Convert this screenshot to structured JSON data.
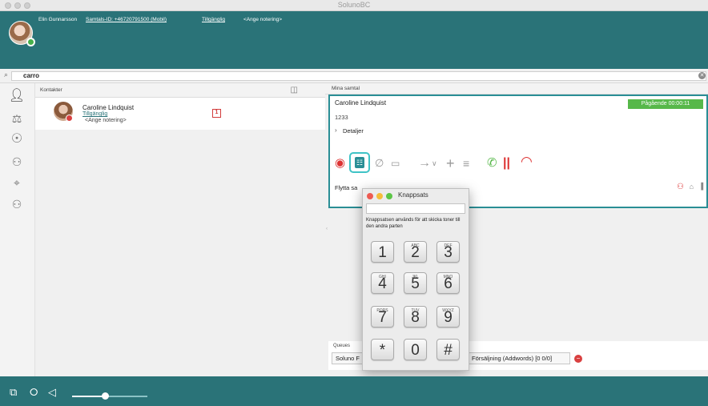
{
  "window": {
    "title": "SolunoBC"
  },
  "header": {
    "user_name": "Elin Gunnarsson",
    "call_id": "Samtals-ID: +46720791500 (Mobil)",
    "status": "Tillgänglig",
    "note": "<Ange notering>"
  },
  "search": {
    "value": "carro"
  },
  "contacts": {
    "title": "Kontakter",
    "items": [
      {
        "name": "Caroline Lindquist",
        "status": "Tillgänglig",
        "note": "<Ange notering>",
        "calendar": "1"
      }
    ]
  },
  "calls": {
    "title": "Mina samtal",
    "current": {
      "name": "Caroline Lindquist",
      "number": "1233",
      "details_label": "Detaljer",
      "status_pill": "Pågående 00:00:11",
      "transfer_label": "Flytta sa"
    }
  },
  "keypad": {
    "title": "Knappsats",
    "help": "Knappsatsen används för att skicka toner till den andra parten",
    "keys": [
      {
        "main": "1",
        "sub": ""
      },
      {
        "main": "2",
        "sub": "ABC"
      },
      {
        "main": "3",
        "sub": "DEF"
      },
      {
        "main": "4",
        "sub": "GHI"
      },
      {
        "main": "5",
        "sub": "JKL"
      },
      {
        "main": "6",
        "sub": "MNO"
      },
      {
        "main": "7",
        "sub": "PQRS"
      },
      {
        "main": "8",
        "sub": "TUV"
      },
      {
        "main": "9",
        "sub": "WXYZ"
      },
      {
        "main": "*",
        "sub": ""
      },
      {
        "main": "0",
        "sub": ""
      },
      {
        "main": "#",
        "sub": ""
      }
    ]
  },
  "queues": {
    "title": "Queues",
    "item1": "Soluno F",
    "item2": "Försäljning (Addwords) [0 0/0]"
  },
  "colors": {
    "brand": "#2a7378",
    "accent": "#3fc3c6",
    "active": "#57b84a",
    "danger": "#d94040"
  }
}
